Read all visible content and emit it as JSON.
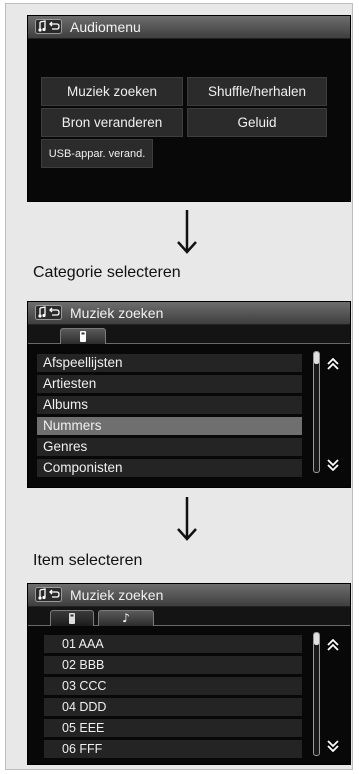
{
  "screen1": {
    "title": "Audiomenu",
    "buttons": [
      "Muziek zoeken",
      "Shuffle/herhalen",
      "Bron veranderen",
      "Geluid",
      "USB-appar. verand."
    ]
  },
  "step1_label": "Categorie selecteren",
  "screen2": {
    "title": "Muziek zoeken",
    "tab_icon": "usb-device-icon",
    "list": [
      "Afspeellijsten",
      "Artiesten",
      "Albums",
      "Nummers",
      "Genres",
      "Componisten"
    ],
    "selected_index": 3
  },
  "step2_label": "Item selecteren",
  "screen3": {
    "title": "Muziek zoeken",
    "tab_icons": [
      "usb-device-icon",
      "music-note-icon"
    ],
    "tab2_glyph": "♪",
    "list": [
      "01 AAA",
      "02 BBB",
      "03 CCC",
      "04 DDD",
      "05 EEE",
      "06 FFF"
    ]
  },
  "colors": {
    "screen_bg": "#080808",
    "header": "#5a5a5a",
    "row": "#242424",
    "selected_row": "#6f6f6f"
  }
}
